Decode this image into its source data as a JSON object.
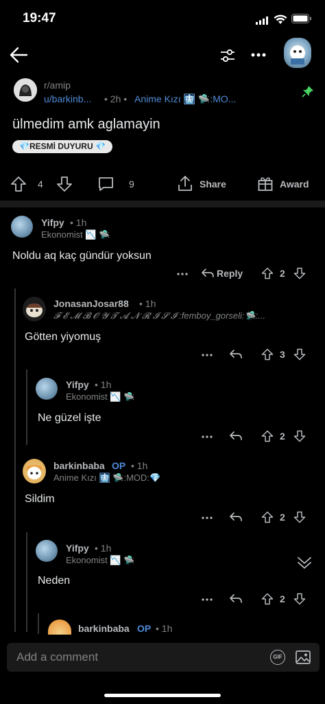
{
  "status_bar": {
    "time": "19:47"
  },
  "post": {
    "subreddit": "r/amip",
    "author": "u/barkinb...",
    "age": "• 2h •",
    "author_flair": "Anime Kızı 🩻 🛸:MO...",
    "title": "ülmedim amk aglamayin",
    "flair": "💎RESMİ DUYURU 💎",
    "upvotes": "4",
    "comments": "9",
    "share_label": "Share",
    "award_label": "Award"
  },
  "comments": [
    {
      "user": "Yifpy",
      "age": "• 1h",
      "flair": "Ekonomist 📉 🛸",
      "text": "Noldu aq kaç gündür yoksun",
      "votes": "2",
      "reply_label": "Reply"
    },
    {
      "user": "JonasanJosar88",
      "age": "• 1h",
      "flair": "𝓕 𝓔 𝓜 𝓑 𝓞 𝓨 𝓣 𝓐 𝓝 𝓡 𝓘 𝓢 𝓘 :femboy_gorseli:🛸:...",
      "text": "Götten yiyomuş",
      "votes": "3"
    },
    {
      "user": "Yifpy",
      "age": "• 1h",
      "flair": "Ekonomist 📉 🛸",
      "text": "Ne güzel işte",
      "votes": "2"
    },
    {
      "user": "barkinbaba",
      "op": "OP",
      "age": "• 1h",
      "flair": "Anime Kızı 🩻 🛸:MOD:💎",
      "text": "Sildim",
      "votes": "2"
    },
    {
      "user": "Yifpy",
      "age": "• 1h",
      "flair": "Ekonomist 📉 🛸",
      "text": "Neden",
      "votes": "2"
    },
    {
      "user": "barkinbaba",
      "op": "OP",
      "age": "• 1h"
    }
  ],
  "composer": {
    "placeholder": "Add a comment",
    "gif_label": "GIF"
  }
}
